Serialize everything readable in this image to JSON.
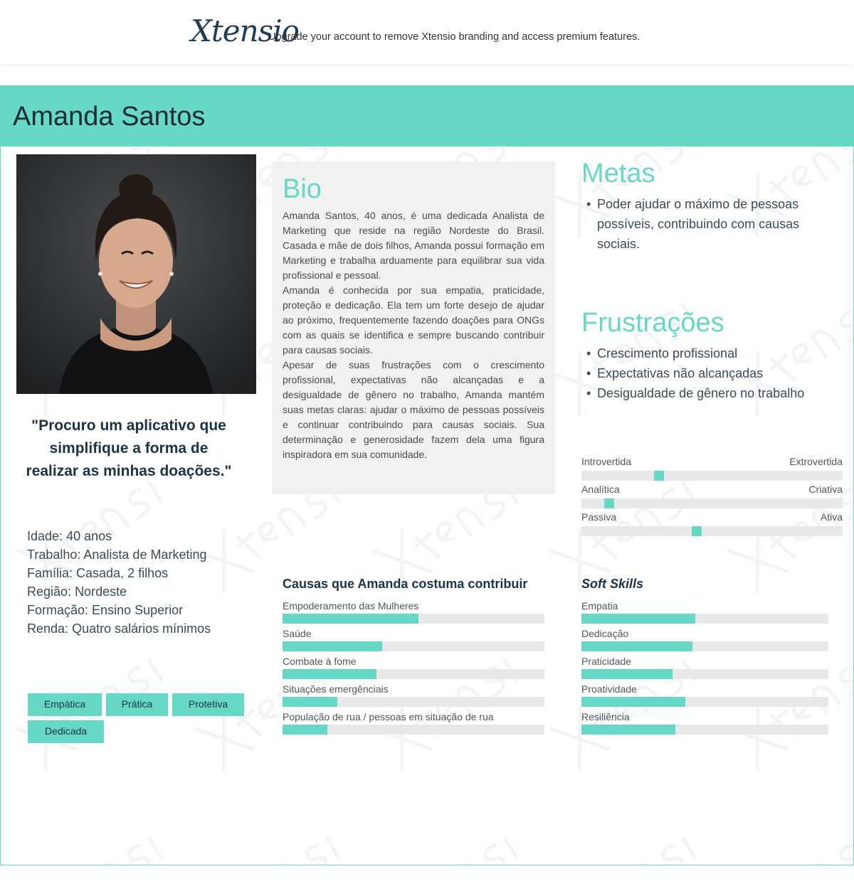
{
  "topbar": {
    "brand": "Xtensio",
    "promo": "Upgrade your account to remove Xtensio branding and access premium features."
  },
  "persona": {
    "name": "Amanda Santos",
    "quote": "\"Procuro um aplicativo que simplifique a forma de realizar as minhas doações.\"",
    "demographics": [
      {
        "label": "Idade:",
        "value": "40 anos"
      },
      {
        "label": "Trabalho:",
        "value": "Analista de Marketing"
      },
      {
        "label": "Família:",
        "value": "Casada, 2 filhos"
      },
      {
        "label": "Região:",
        "value": "Nordeste"
      },
      {
        "label": "Formação:",
        "value": "Ensino Superior"
      },
      {
        "label": "Renda:",
        "value": "Quatro salários mínimos"
      }
    ],
    "tags": [
      "Empática",
      "Prática",
      "Protetiva",
      "Dedicada"
    ]
  },
  "bio": {
    "title": "Bio",
    "paragraphs": [
      "Amanda Santos, 40 anos, é uma dedicada Analista de Marketing que reside na região Nordeste do Brasil. Casada e mãe de dois filhos, Amanda possui formação em Marketing e trabalha arduamente para equilibrar sua vida profissional e pessoal.",
      " Amanda é conhecida por sua empatia, praticidade, proteção e dedicação. Ela tem um forte desejo de ajudar ao próximo, frequentemente fazendo doações para ONGs com as quais se identifica e sempre buscando contribuir para causas sociais.",
      "Apesar de suas frustrações com o crescimento profissional, expectativas não alcançadas e a desigualdade de gênero no trabalho, Amanda mantém suas metas claras: ajudar o máximo de pessoas possíveis e continuar contribuindo para causas sociais. Sua determinação e generosidade fazem dela uma figura inspiradora em sua comunidade."
    ]
  },
  "goals": {
    "title": "Metas",
    "items": [
      "Poder ajudar o máximo de pessoas possíveis, contribuindo com causas sociais."
    ]
  },
  "frustrations": {
    "title": "Frustrações",
    "items": [
      "Crescimento profissional",
      "Expectativas não alcançadas",
      "Desigualdade de gênero no trabalho"
    ]
  },
  "personality": [
    {
      "left": "Introvertida",
      "right": "Extrovertida",
      "value": 0.29
    },
    {
      "left": "Analítica",
      "right": "Criativa",
      "value": 0.09
    },
    {
      "left": "Passiva",
      "right": "Ativa",
      "value": 0.44
    }
  ],
  "causes": {
    "title": "Causas que Amanda costuma contribuir",
    "items": [
      {
        "label": "Empoderamento das Mulheres",
        "value": 0.52
      },
      {
        "label": "Saúde",
        "value": 0.38
      },
      {
        "label": "Combate à fome",
        "value": 0.36
      },
      {
        "label": "Situações emergênciais",
        "value": 0.21
      },
      {
        "label": "População de rua / pessoas em situação de rua",
        "value": 0.17
      }
    ]
  },
  "soft_skills": {
    "title": "Soft Skills",
    "items": [
      {
        "label": "Empatia",
        "value": 0.46
      },
      {
        "label": "Dedicação",
        "value": 0.45
      },
      {
        "label": "Praticidade",
        "value": 0.37
      },
      {
        "label": "Proatividade",
        "value": 0.42
      },
      {
        "label": "Resiliência",
        "value": 0.38
      }
    ]
  },
  "colors": {
    "accent": "#66d9c6",
    "dark_text": "#1c3346",
    "track": "#e8e8ea"
  }
}
